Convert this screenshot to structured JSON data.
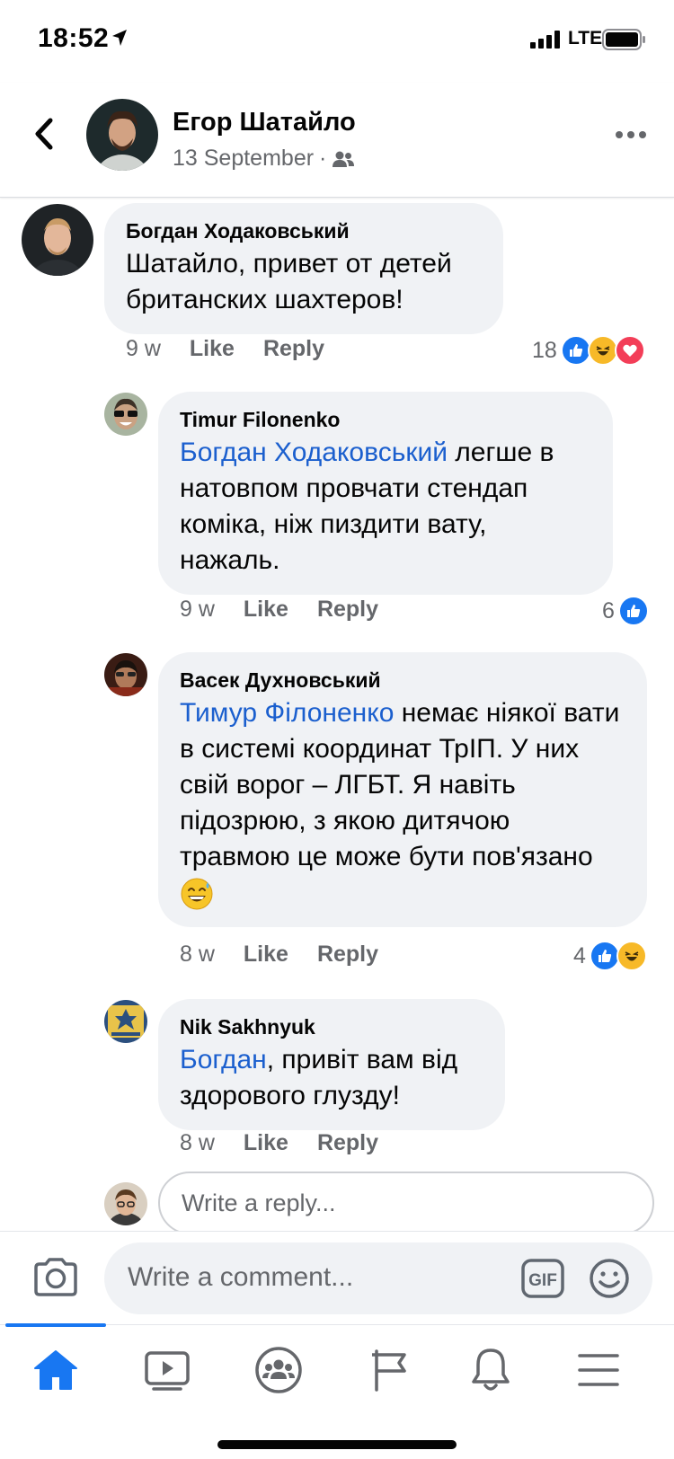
{
  "status_bar": {
    "time": "18:52",
    "network": "LTE"
  },
  "post_header": {
    "author": "Егор Шатайло",
    "date": "13 September",
    "separator": "·"
  },
  "comments": [
    {
      "author": "Богдан Ходаковський",
      "mention": "",
      "text": "Шатайло, привет от детей британских шахтеров!",
      "time": "9 w",
      "like": "Like",
      "reply": "Reply",
      "reaction_count": "18",
      "reactions": [
        "like",
        "haha",
        "love"
      ]
    },
    {
      "author": "Timur Filonenko",
      "mention": "Богдан Ходаковський",
      "text": " легше в натовпом провчати стендап коміка, ніж пиздити вату, нажаль.",
      "time": "9 w",
      "like": "Like",
      "reply": "Reply",
      "reaction_count": "6",
      "reactions": [
        "like"
      ]
    },
    {
      "author": "Васек Духновський",
      "mention": "Тимур Філоненко",
      "text": " немає ніякої вати в системі координат ТрІП. У них свій ворог – ЛГБТ. Я навіть підозрюю, з якою дитячою травмою це може бути пов'язано",
      "emoji": "sweat-smile-emoji",
      "time": "8 w",
      "like": "Like",
      "reply": "Reply",
      "reaction_count": "4",
      "reactions": [
        "like",
        "haha"
      ]
    },
    {
      "author": "Nik Sakhnyuk",
      "mention": "Богдан",
      "text": ", привіт вам від здорового глузду!",
      "time": "8 w",
      "like": "Like",
      "reply": "Reply",
      "reaction_count": "",
      "reactions": []
    }
  ],
  "reply_input": {
    "placeholder": "Write a reply..."
  },
  "comment_bar": {
    "placeholder": "Write a comment...",
    "gif_label": "GIF"
  },
  "tabs": [
    "home-icon",
    "watch-icon",
    "groups-icon",
    "pages-flag-icon",
    "notifications-bell-icon",
    "menu-icon"
  ],
  "colors": {
    "accent": "#1877f2",
    "mention": "#1b5fce",
    "bubble": "#f0f2f5",
    "secondary_text": "#65676b"
  }
}
